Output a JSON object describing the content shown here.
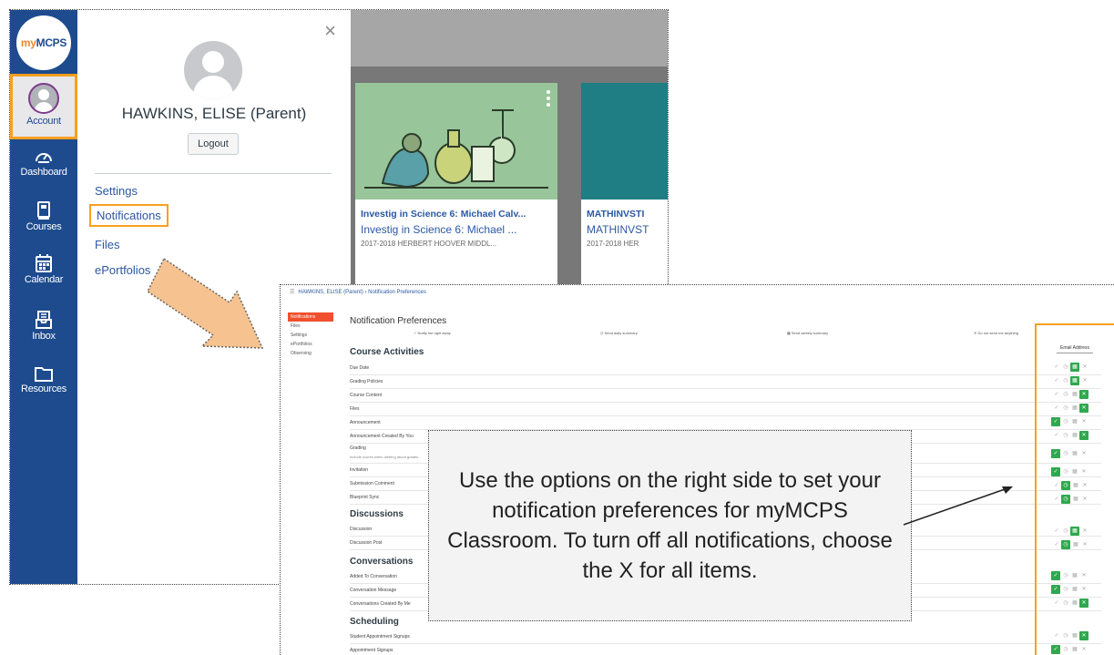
{
  "global_nav": {
    "logo": {
      "part1": "my",
      "part2": "MCPS"
    },
    "items": [
      {
        "label": "Account",
        "icon": "account-avatar-icon"
      },
      {
        "label": "Dashboard",
        "icon": "dashboard-icon"
      },
      {
        "label": "Courses",
        "icon": "courses-icon"
      },
      {
        "label": "Calendar",
        "icon": "calendar-icon"
      },
      {
        "label": "Inbox",
        "icon": "inbox-icon"
      },
      {
        "label": "Resources",
        "icon": "folder-icon"
      }
    ],
    "highlight_color": "#f7a01f",
    "nav_color": "#1d4b8e"
  },
  "account_tray": {
    "close_glyph": "×",
    "user_name": "HAWKINS, ELISE (Parent)",
    "logout_label": "Logout",
    "links": [
      "Settings",
      "Notifications",
      "Files",
      "ePortfolios"
    ]
  },
  "course_cards": [
    {
      "title": "Investig in Science 6: Michael Calv...",
      "subtitle": "Investig in Science 6: Michael ...",
      "term": "2017-2018 HERBERT HOOVER MIDDL..."
    },
    {
      "title": "MATHINVSTI",
      "subtitle": "MATHINVST",
      "term": "2017-2018 HER"
    }
  ],
  "notification_prefs": {
    "breadcrumb": "HAWKINS, ELISE (Parent) › Notification Preferences",
    "left_nav": [
      "Notifications",
      "Files",
      "Settings",
      "ePortfolios",
      "Observing"
    ],
    "title": "Notification Preferences",
    "legend": [
      "✓ Notify me right away",
      "◷ Send daily summary",
      "▦ Send weekly summary",
      "✕ Do not send me anything"
    ],
    "email_column_header": "Email Address",
    "sections": [
      {
        "heading": "Course Activities",
        "rows": [
          "Due Date",
          "Grading Policies",
          "Course Content",
          "Files",
          "Announcement",
          "Announcement Created By You",
          "Grading",
          "Invitation",
          "Submission Comment",
          "Blueprint Sync"
        ]
      },
      {
        "heading": "Discussions",
        "rows": [
          "Discussion",
          "Discussion Post"
        ]
      },
      {
        "heading": "Conversations",
        "rows": [
          "Added To Conversation",
          "Conversation Message",
          "Conversations Created By Me"
        ]
      },
      {
        "heading": "Scheduling",
        "rows": [
          "Student Appointment Signups",
          "Appointment Signups"
        ]
      }
    ],
    "grading_note": "Include scores when alerting about grades.",
    "selected_color": "#2fa84f"
  },
  "callout": {
    "text": "Use the options on the right side to set your notification preferences for myMCPS Classroom. To turn off all notifications, choose the X for all items."
  }
}
